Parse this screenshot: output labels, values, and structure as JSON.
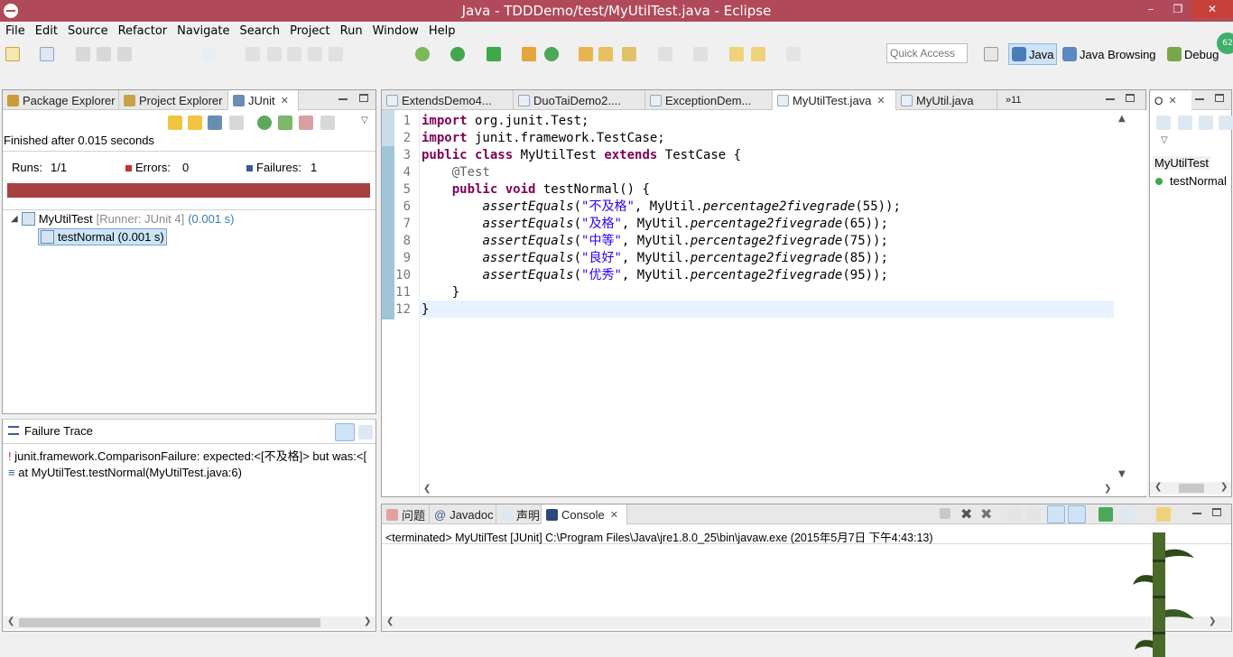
{
  "window": {
    "title": "Java - TDDDemo/test/MyUtilTest.java - Eclipse",
    "buttons": [
      "–",
      "❐",
      "✕"
    ]
  },
  "menu": [
    "File",
    "Edit",
    "Source",
    "Refactor",
    "Navigate",
    "Search",
    "Project",
    "Run",
    "Window",
    "Help"
  ],
  "toolbar": {
    "quick_access_placeholder": "Quick Access",
    "perspectives": [
      {
        "label": "Java",
        "active": true
      },
      {
        "label": "Java Browsing",
        "active": false
      },
      {
        "label": "Debug",
        "active": false
      }
    ],
    "badge": "62"
  },
  "left_panel": {
    "tabs": [
      {
        "label": "Package Explorer",
        "active": false
      },
      {
        "label": "Project Explorer",
        "active": false
      },
      {
        "label": "JUnit",
        "active": true
      }
    ],
    "finished": "Finished after 0.015 seconds",
    "runs_label": "Runs:",
    "runs_value": "1/1",
    "errors_label": "Errors:",
    "errors_value": "0",
    "failures_label": "Failures:",
    "failures_value": "1",
    "tree": [
      {
        "name": "MyUtilTest",
        "detail": "[Runner: JUnit 4]",
        "time": "(0.001 s)"
      },
      {
        "name": "testNormal (0.001 s)"
      }
    ],
    "failure_trace_title": "Failure Trace",
    "trace": [
      "junit.framework.ComparisonFailure: expected:<[不及格]> but was:<[",
      "at MyUtilTest.testNormal(MyUtilTest.java:6)"
    ]
  },
  "editor": {
    "tabs": [
      {
        "label": "ExtendsDemo4...",
        "active": false
      },
      {
        "label": "DuoTaiDemo2....",
        "active": false
      },
      {
        "label": "ExceptionDem...",
        "active": false
      },
      {
        "label": "MyUtilTest.java",
        "active": true
      },
      {
        "label": "MyUtil.java",
        "active": false
      }
    ],
    "overflow": "»11",
    "line_numbers": [
      "1",
      "2",
      "3",
      "4",
      "5",
      "6",
      "7",
      "8",
      "9",
      "10",
      "11",
      "12"
    ],
    "lines": {
      "l1_kw": "import",
      "l1_rest": " org.junit.Test;",
      "l2_kw": "import",
      "l2_rest": " junit.framework.TestCase;",
      "l3_kw1": "public",
      "l3_kw2": "class",
      "l3_name": " MyUtilTest ",
      "l3_kw3": "extends",
      "l3_rest": " TestCase {",
      "l4": "    @Test",
      "l5_kw1": "public",
      "l5_kw2": "void",
      "l5_rest": " testNormal() {",
      "assert_fn": "assertEquals",
      "util": "MyUtil.",
      "method": "percentage2fivegrade",
      "asserts": [
        {
          "expected": "\"不及格\"",
          "arg": "(55));"
        },
        {
          "expected": "\"及格\"",
          "arg": "(65));"
        },
        {
          "expected": "\"中等\"",
          "arg": "(75));"
        },
        {
          "expected": "\"良好\"",
          "arg": "(85));"
        },
        {
          "expected": "\"优秀\"",
          "arg": "(95));"
        }
      ],
      "l11": "    }",
      "l12": "}"
    }
  },
  "outline": {
    "class_name": "MyUtilTest",
    "method": "testNormal"
  },
  "bottom_panel": {
    "tabs": [
      {
        "label": "问题",
        "active": false
      },
      {
        "label": "Javadoc",
        "active": false
      },
      {
        "label": "声明",
        "active": false
      },
      {
        "label": "Console",
        "active": true
      }
    ],
    "console_line": "<terminated> MyUtilTest [JUnit] C:\\Program Files\\Java\\jre1.8.0_25\\bin\\javaw.exe (2015年5月7日 下午4:43:13)"
  },
  "colors": {
    "title_bar": "#b04a5a",
    "failure_bar": "#a6413f",
    "keyword": "#7f0055",
    "string": "#2a00ff"
  }
}
